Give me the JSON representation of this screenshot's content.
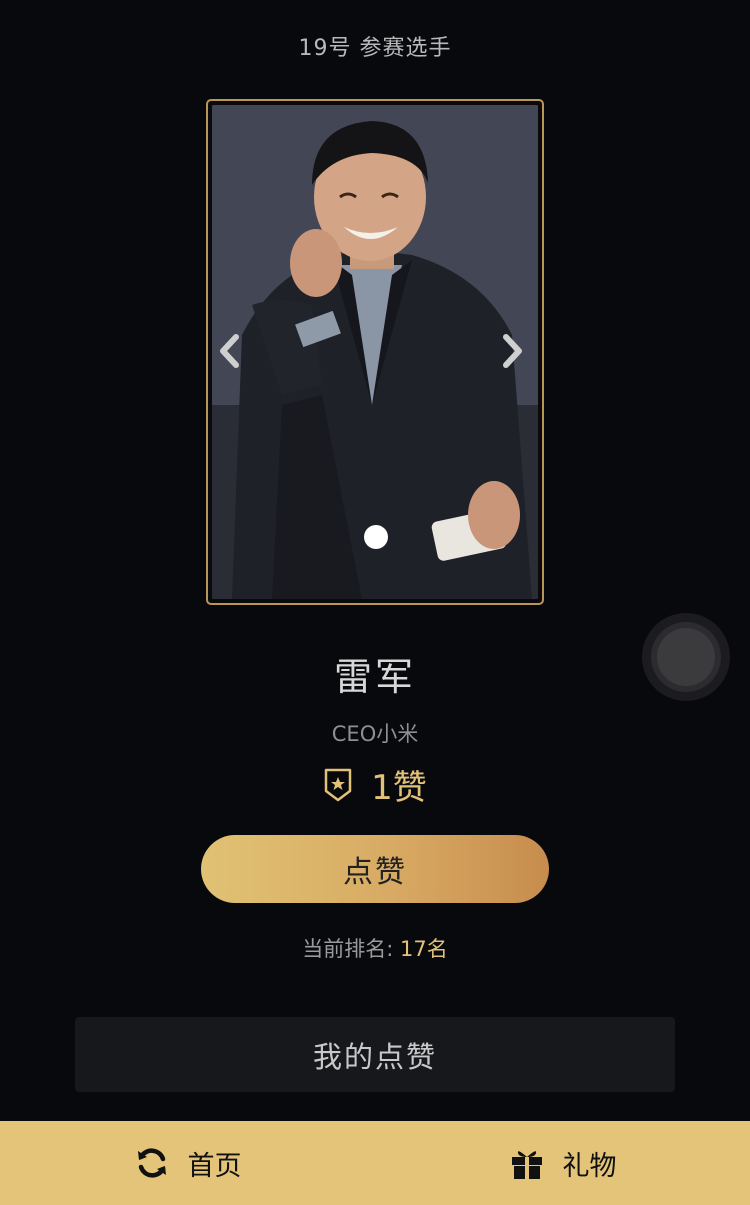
{
  "header": {
    "title": "19号  参赛选手"
  },
  "contestant": {
    "name": "雷军",
    "title": "CEO小米",
    "likes": "1赞",
    "like_button_label": "点赞",
    "rank_label": "当前排名:",
    "rank_value": "17名"
  },
  "carousel": {
    "prev_icon": "chevron-left-icon",
    "next_icon": "chevron-right-icon"
  },
  "my_likes_button": "我的点赞",
  "bottom_nav": {
    "home_label": "首页",
    "home_icon": "refresh-icon",
    "gift_label": "礼物",
    "gift_icon": "gift-icon"
  },
  "colors": {
    "accent_gold": "#e3c479",
    "background": "#08090c"
  }
}
